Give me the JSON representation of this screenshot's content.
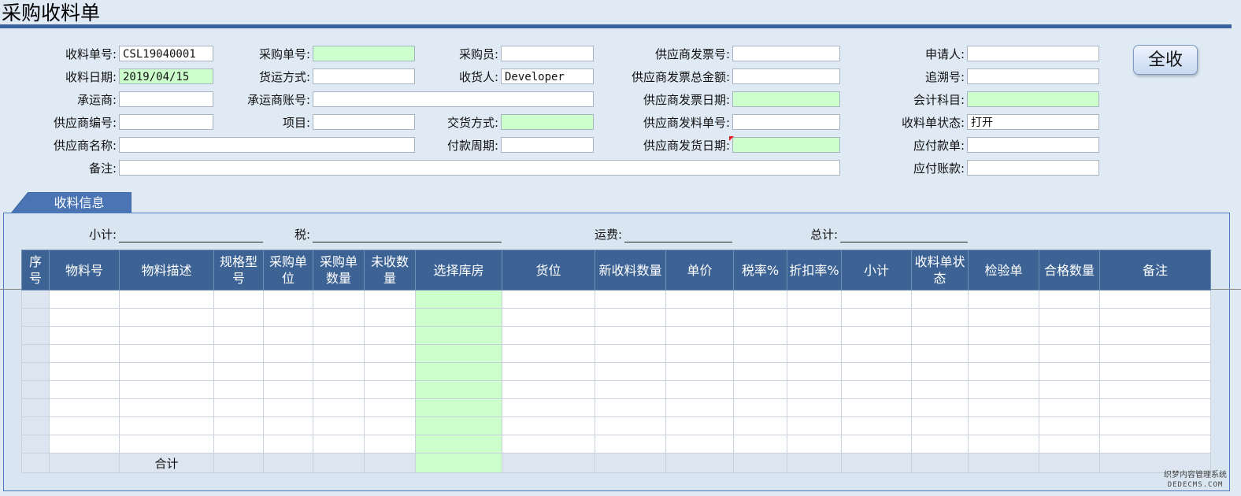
{
  "title": "采购收料单",
  "form": {
    "receipt_no": {
      "label": "收料单号:",
      "value": "CSL19040001"
    },
    "receipt_date": {
      "label": "收料日期:",
      "value": "2019/04/15"
    },
    "carrier": {
      "label": "承运商:",
      "value": ""
    },
    "supplier_code": {
      "label": "供应商编号:",
      "value": ""
    },
    "supplier_name": {
      "label": "供应商名称:",
      "value": ""
    },
    "remark": {
      "label": "备注:",
      "value": ""
    },
    "po_no": {
      "label": "采购单号:",
      "value": ""
    },
    "ship_method": {
      "label": "货运方式:",
      "value": ""
    },
    "carrier_account": {
      "label": "承运商账号:",
      "value": ""
    },
    "project": {
      "label": "项目:",
      "value": ""
    },
    "buyer": {
      "label": "采购员:",
      "value": ""
    },
    "receiver": {
      "label": "收货人:",
      "value": "Developer"
    },
    "delivery_method": {
      "label": "交货方式:",
      "value": ""
    },
    "payment_cycle": {
      "label": "付款周期:",
      "value": ""
    },
    "supplier_invoice_no": {
      "label": "供应商发票号:",
      "value": ""
    },
    "supplier_invoice_total": {
      "label": "供应商发票总金额:",
      "value": ""
    },
    "supplier_invoice_date": {
      "label": "供应商发票日期:",
      "value": ""
    },
    "supplier_dispatch_no": {
      "label": "供应商发料单号:",
      "value": ""
    },
    "supplier_ship_date": {
      "label": "供应商发货日期:",
      "value": ""
    },
    "applicant": {
      "label": "申请人:",
      "value": ""
    },
    "trace_no": {
      "label": "追溯号:",
      "value": ""
    },
    "account_subject": {
      "label": "会计科目:",
      "value": ""
    },
    "receipt_status": {
      "label": "收料单状态:",
      "value": "打开"
    },
    "payable_doc": {
      "label": "应付款单:",
      "value": ""
    },
    "payable_account": {
      "label": "应付账款:",
      "value": ""
    }
  },
  "receive_all_button": "全收",
  "tab_label": "收料信息",
  "summary": {
    "subtotal_label": "小计:",
    "tax_label": "税:",
    "freight_label": "运费:",
    "total_label": "总计:"
  },
  "grid": {
    "columns": [
      "序号",
      "物料号",
      "物料描述",
      "规格型号",
      "采购单位",
      "采购单数量",
      "未收数量",
      "选择库房",
      "货位",
      "新收料数量",
      "单价",
      "税率%",
      "折扣率%",
      "小计",
      "收料单状态",
      "检验单",
      "合格数量",
      "备注"
    ],
    "empty_rows": 9,
    "total_label": "合计"
  },
  "watermark": {
    "line1": "织梦内容管理系统",
    "line2": "DEDECMS.COM"
  },
  "colors": {
    "header_bg": "#3d6395",
    "required_field": "#ccffcc",
    "accent": "#3a62a0"
  }
}
